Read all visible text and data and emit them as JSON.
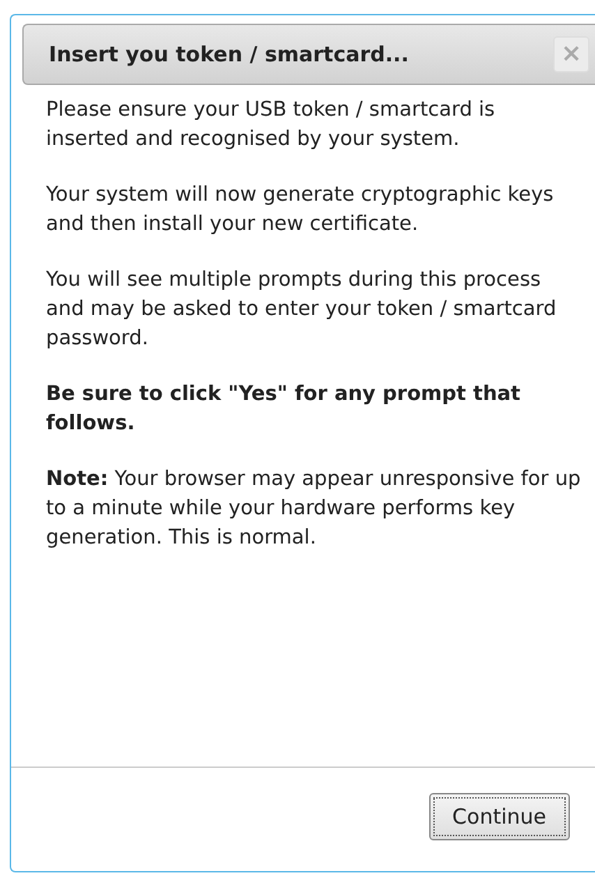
{
  "dialog": {
    "title": "Insert you token / smartcard...",
    "close": "×",
    "paragraphs": [
      {
        "kind": "plain",
        "text": "Please ensure your USB token / smartcard is inserted and recognised by your system."
      },
      {
        "kind": "plain",
        "text": "Your system will now generate cryptographic keys and then install your new certificate."
      },
      {
        "kind": "plain",
        "text": "You will see multiple prompts during this process and may be asked to enter your token / smartcard password."
      },
      {
        "kind": "bold",
        "text": "Be sure to click \"Yes\" for any prompt that follows."
      },
      {
        "kind": "plain",
        "text": "**Note:** Your browser may appear unresponsive for up to a minute while your hardware performs key generation. This is normal."
      }
    ],
    "buttons": [
      "Continue"
    ]
  }
}
